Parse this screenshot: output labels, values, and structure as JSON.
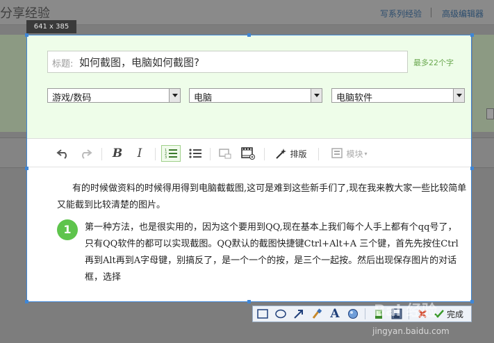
{
  "background": {
    "page_title": "分享经验",
    "links": [
      "写系列经验",
      "高级编辑器"
    ]
  },
  "capture": {
    "size_label": "641 x 385"
  },
  "form": {
    "title_label": "标题:",
    "title_value": "如何截图，电脑如何截图?",
    "title_hint": "最多22个字",
    "selects": [
      "游戏/数码",
      "电脑",
      "电脑软件"
    ]
  },
  "toolbar": {
    "typeset_label": "排版",
    "module_label": "模块"
  },
  "content": {
    "paragraph": "有的时候做资料的时候得用得到电脑截截图,这可是难到这些新手们了,现在我来教大家一些比较简单又能截到比较清楚的图片。",
    "step_number": "1",
    "step_text": "第一种方法，也是很实用的，因为这个要用到QQ,现在基本上我们每个人手上都有个qq号了，只有QQ软件的都可以实现截图。QQ默认的截图快捷键Ctrl+Alt+A 三个键，首先先按住Ctrl再到Alt再到A字母键，别搞反了，是一个一个的按，是三个一起按。然后出现保存图片的对话框，选择"
  },
  "capture_toolbar": {
    "done_label": "完成"
  },
  "watermark": {
    "brand": "Bai 经验",
    "url": "jingyan.baidu.com"
  },
  "colors": {
    "accent": "#3e86d6",
    "form_bg": "#eefde9",
    "step_green": "#5ec44c",
    "hint_green": "#6aa84f"
  }
}
